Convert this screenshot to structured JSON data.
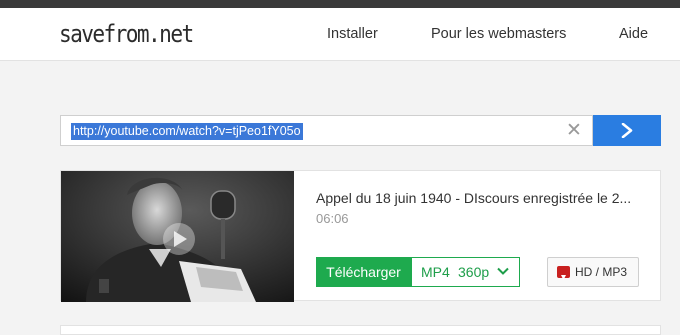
{
  "browser_strip": {
    "text": ""
  },
  "header": {
    "logo": "savefrom.net",
    "nav": [
      "Installer",
      "Pour les webmasters",
      "Aide"
    ]
  },
  "search": {
    "value": "http://youtube.com/watch?v=tjPeo1fY05o"
  },
  "result": {
    "title": "Appel du 18 juin 1940 - DIscours enregistrée le 2...",
    "duration": "06:06",
    "download_label": "Télécharger",
    "format": "MP4",
    "resolution": "360p",
    "hd_label": "HD / MP3"
  },
  "colors": {
    "accent_blue": "#2a7de1",
    "download_green": "#1eaa4e",
    "hd_icon_red": "#c8201f"
  },
  "icons": [
    "clear-icon",
    "arrow-right-icon",
    "play-icon",
    "chevron-down-icon",
    "download-icon"
  ]
}
